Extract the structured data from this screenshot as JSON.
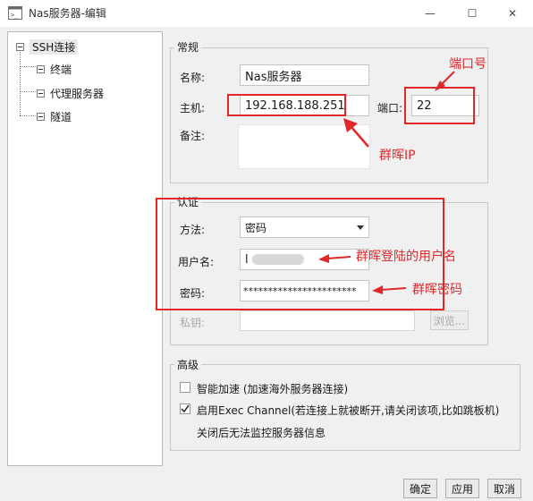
{
  "window": {
    "title": "Nas服务器-编辑",
    "min_glyph": "—",
    "max_glyph": "☐",
    "close_glyph": "✕"
  },
  "tree": {
    "root": "SSH连接",
    "children": [
      "终端",
      "代理服务器",
      "隧道"
    ]
  },
  "general": {
    "title": "常规",
    "name_label": "名称:",
    "name_value": "Nas服务器",
    "host_label": "主机:",
    "host_value": "192.168.188.251",
    "port_label": "端口:",
    "port_value": "22",
    "note_label": "备注:",
    "note_value": ""
  },
  "auth": {
    "title": "认证",
    "method_label": "方法:",
    "method_value": "密码",
    "user_label": "用户名:",
    "user_value": "l",
    "password_label": "密码:",
    "password_value": "***********************",
    "key_label": "私钥:",
    "key_value": "",
    "browse_label": "浏览..."
  },
  "advanced": {
    "title": "高级",
    "accel_label": "智能加速 (加速海外服务器连接)",
    "accel_checked": false,
    "exec_label": "启用Exec Channel(若连接上就被断开,请关闭该项,比如跳板机)",
    "exec_checked": true,
    "exec_note": "关闭后无法监控服务器信息"
  },
  "annotations": {
    "port": "端口号",
    "host": "群晖IP",
    "user": "群晖登陆的用户名",
    "password": "群晖密码"
  },
  "buttons": {
    "ok": "确定",
    "apply": "应用",
    "cancel": "取消"
  },
  "colors": {
    "annotation_red": "#e0282b"
  }
}
